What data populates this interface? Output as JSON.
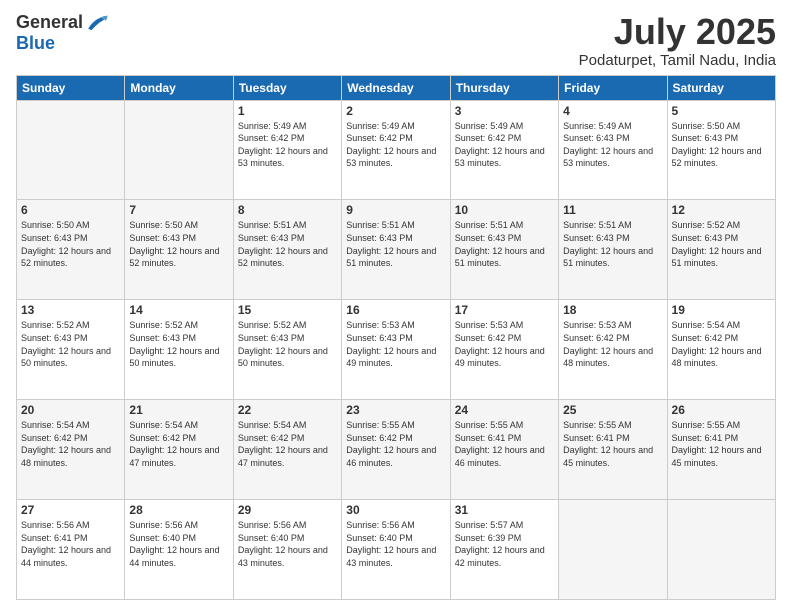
{
  "logo": {
    "general": "General",
    "blue": "Blue"
  },
  "header": {
    "title": "July 2025",
    "subtitle": "Podaturpet, Tamil Nadu, India"
  },
  "days_of_week": [
    "Sunday",
    "Monday",
    "Tuesday",
    "Wednesday",
    "Thursday",
    "Friday",
    "Saturday"
  ],
  "weeks": [
    [
      {
        "day": "",
        "info": ""
      },
      {
        "day": "",
        "info": ""
      },
      {
        "day": "1",
        "info": "Sunrise: 5:49 AM\nSunset: 6:42 PM\nDaylight: 12 hours and 53 minutes."
      },
      {
        "day": "2",
        "info": "Sunrise: 5:49 AM\nSunset: 6:42 PM\nDaylight: 12 hours and 53 minutes."
      },
      {
        "day": "3",
        "info": "Sunrise: 5:49 AM\nSunset: 6:42 PM\nDaylight: 12 hours and 53 minutes."
      },
      {
        "day": "4",
        "info": "Sunrise: 5:49 AM\nSunset: 6:43 PM\nDaylight: 12 hours and 53 minutes."
      },
      {
        "day": "5",
        "info": "Sunrise: 5:50 AM\nSunset: 6:43 PM\nDaylight: 12 hours and 52 minutes."
      }
    ],
    [
      {
        "day": "6",
        "info": "Sunrise: 5:50 AM\nSunset: 6:43 PM\nDaylight: 12 hours and 52 minutes."
      },
      {
        "day": "7",
        "info": "Sunrise: 5:50 AM\nSunset: 6:43 PM\nDaylight: 12 hours and 52 minutes."
      },
      {
        "day": "8",
        "info": "Sunrise: 5:51 AM\nSunset: 6:43 PM\nDaylight: 12 hours and 52 minutes."
      },
      {
        "day": "9",
        "info": "Sunrise: 5:51 AM\nSunset: 6:43 PM\nDaylight: 12 hours and 51 minutes."
      },
      {
        "day": "10",
        "info": "Sunrise: 5:51 AM\nSunset: 6:43 PM\nDaylight: 12 hours and 51 minutes."
      },
      {
        "day": "11",
        "info": "Sunrise: 5:51 AM\nSunset: 6:43 PM\nDaylight: 12 hours and 51 minutes."
      },
      {
        "day": "12",
        "info": "Sunrise: 5:52 AM\nSunset: 6:43 PM\nDaylight: 12 hours and 51 minutes."
      }
    ],
    [
      {
        "day": "13",
        "info": "Sunrise: 5:52 AM\nSunset: 6:43 PM\nDaylight: 12 hours and 50 minutes."
      },
      {
        "day": "14",
        "info": "Sunrise: 5:52 AM\nSunset: 6:43 PM\nDaylight: 12 hours and 50 minutes."
      },
      {
        "day": "15",
        "info": "Sunrise: 5:52 AM\nSunset: 6:43 PM\nDaylight: 12 hours and 50 minutes."
      },
      {
        "day": "16",
        "info": "Sunrise: 5:53 AM\nSunset: 6:43 PM\nDaylight: 12 hours and 49 minutes."
      },
      {
        "day": "17",
        "info": "Sunrise: 5:53 AM\nSunset: 6:42 PM\nDaylight: 12 hours and 49 minutes."
      },
      {
        "day": "18",
        "info": "Sunrise: 5:53 AM\nSunset: 6:42 PM\nDaylight: 12 hours and 48 minutes."
      },
      {
        "day": "19",
        "info": "Sunrise: 5:54 AM\nSunset: 6:42 PM\nDaylight: 12 hours and 48 minutes."
      }
    ],
    [
      {
        "day": "20",
        "info": "Sunrise: 5:54 AM\nSunset: 6:42 PM\nDaylight: 12 hours and 48 minutes."
      },
      {
        "day": "21",
        "info": "Sunrise: 5:54 AM\nSunset: 6:42 PM\nDaylight: 12 hours and 47 minutes."
      },
      {
        "day": "22",
        "info": "Sunrise: 5:54 AM\nSunset: 6:42 PM\nDaylight: 12 hours and 47 minutes."
      },
      {
        "day": "23",
        "info": "Sunrise: 5:55 AM\nSunset: 6:42 PM\nDaylight: 12 hours and 46 minutes."
      },
      {
        "day": "24",
        "info": "Sunrise: 5:55 AM\nSunset: 6:41 PM\nDaylight: 12 hours and 46 minutes."
      },
      {
        "day": "25",
        "info": "Sunrise: 5:55 AM\nSunset: 6:41 PM\nDaylight: 12 hours and 45 minutes."
      },
      {
        "day": "26",
        "info": "Sunrise: 5:55 AM\nSunset: 6:41 PM\nDaylight: 12 hours and 45 minutes."
      }
    ],
    [
      {
        "day": "27",
        "info": "Sunrise: 5:56 AM\nSunset: 6:41 PM\nDaylight: 12 hours and 44 minutes."
      },
      {
        "day": "28",
        "info": "Sunrise: 5:56 AM\nSunset: 6:40 PM\nDaylight: 12 hours and 44 minutes."
      },
      {
        "day": "29",
        "info": "Sunrise: 5:56 AM\nSunset: 6:40 PM\nDaylight: 12 hours and 43 minutes."
      },
      {
        "day": "30",
        "info": "Sunrise: 5:56 AM\nSunset: 6:40 PM\nDaylight: 12 hours and 43 minutes."
      },
      {
        "day": "31",
        "info": "Sunrise: 5:57 AM\nSunset: 6:39 PM\nDaylight: 12 hours and 42 minutes."
      },
      {
        "day": "",
        "info": ""
      },
      {
        "day": "",
        "info": ""
      }
    ]
  ]
}
